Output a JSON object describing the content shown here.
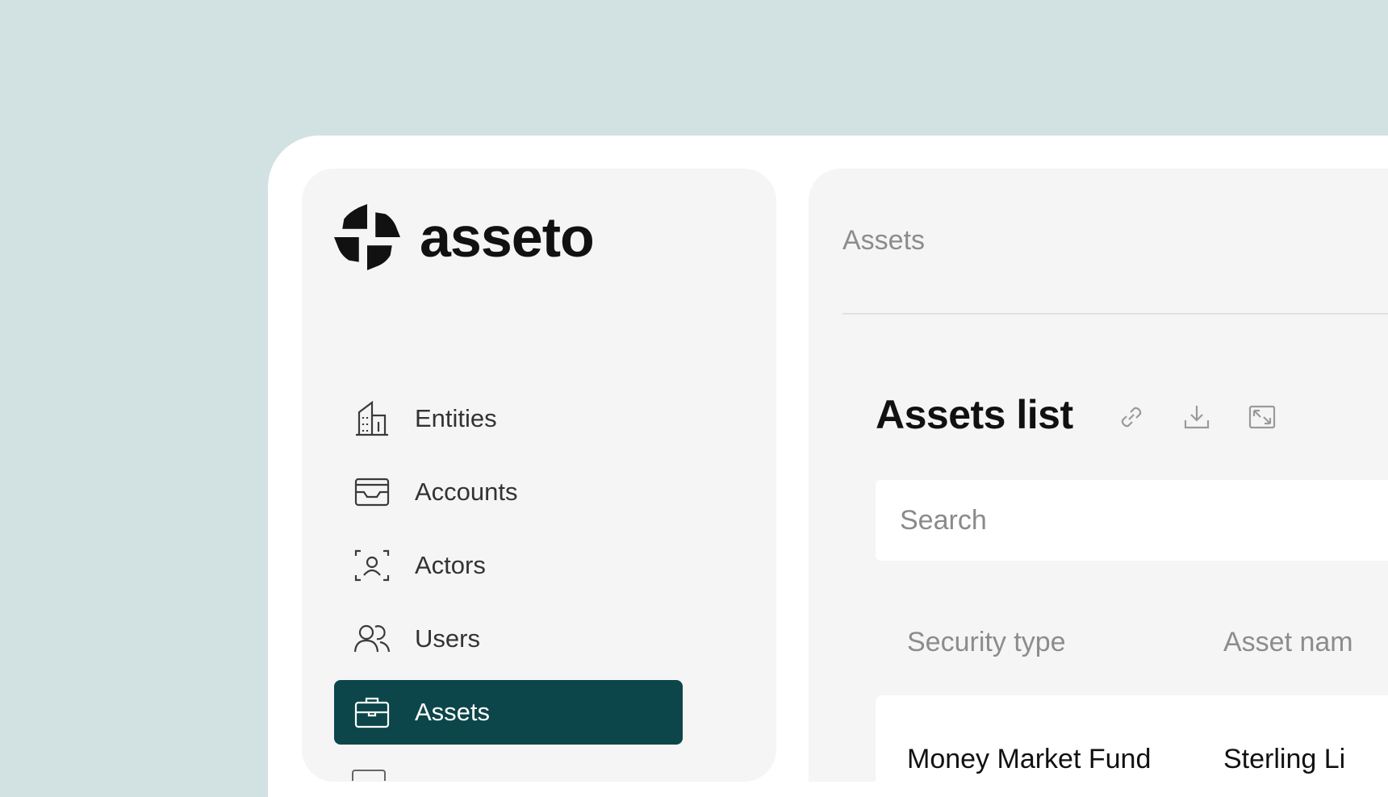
{
  "brand": {
    "name": "asseto"
  },
  "sidebar": {
    "items": [
      {
        "label": "Entities",
        "icon": "building-icon",
        "active": false
      },
      {
        "label": "Accounts",
        "icon": "inbox-icon",
        "active": false
      },
      {
        "label": "Actors",
        "icon": "user-focus-icon",
        "active": false
      },
      {
        "label": "Users",
        "icon": "users-icon",
        "active": false
      },
      {
        "label": "Assets",
        "icon": "briefcase-icon",
        "active": true
      }
    ]
  },
  "main": {
    "breadcrumb": "Assets",
    "title": "Assets list",
    "actions": [
      "link-icon",
      "download-icon",
      "expand-icon"
    ],
    "search": {
      "placeholder": "Search",
      "value": ""
    },
    "table": {
      "columns": [
        "Security type",
        "Asset nam"
      ],
      "rows": [
        [
          "Money Market Fund",
          "Sterling Li"
        ]
      ]
    }
  },
  "colors": {
    "background": "#d2e2e3",
    "accent": "#0d464a",
    "panel": "#f5f5f5"
  }
}
